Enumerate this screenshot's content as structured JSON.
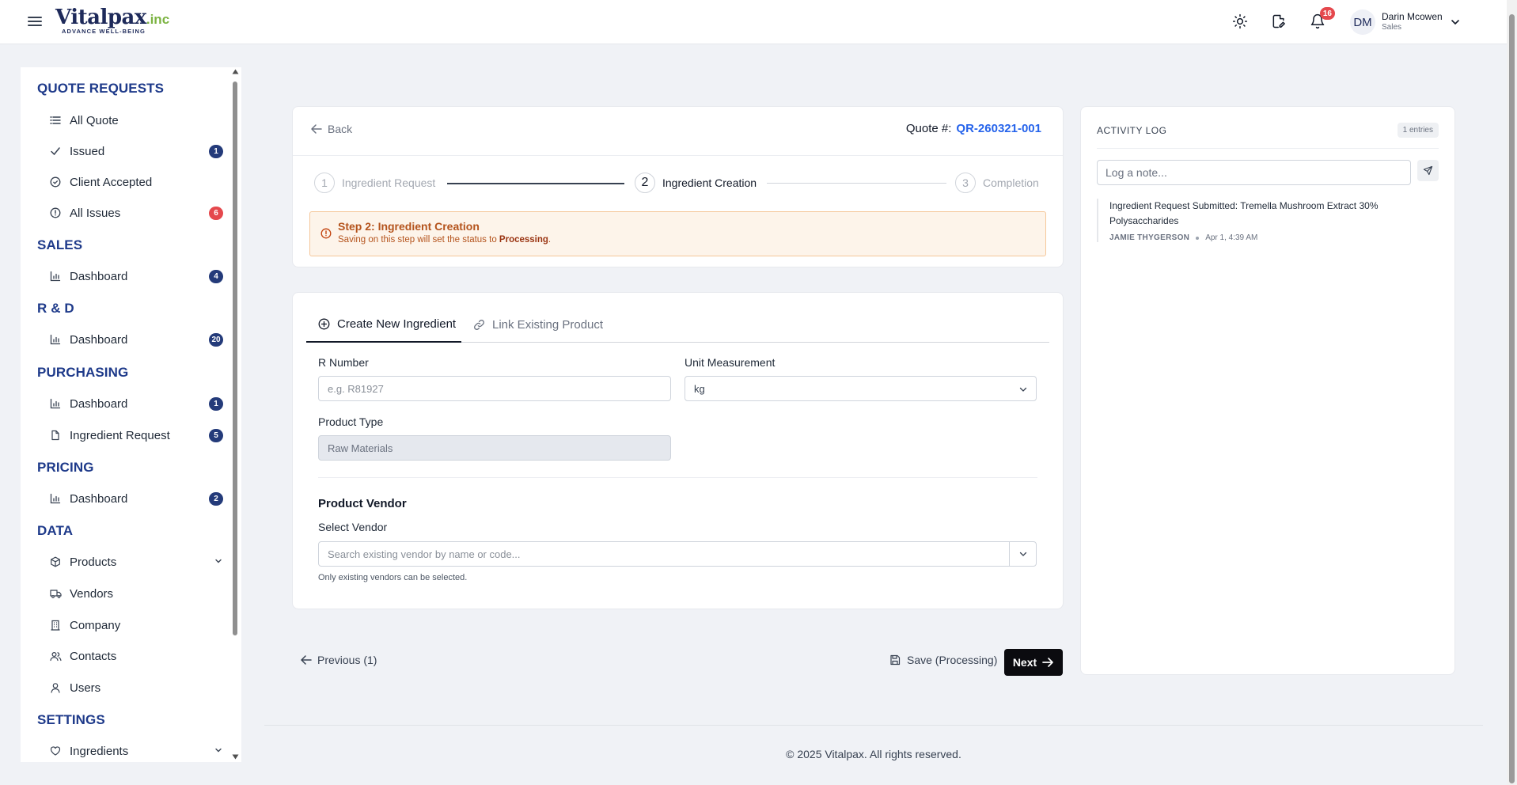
{
  "header": {
    "logo_main": "Vitalpax",
    "logo_suffix": ".inc",
    "logo_tagline": "ADVANCE WELL-BEING",
    "notification_count": "16",
    "user": {
      "initials": "DM",
      "name": "Darin Mcowen",
      "role": "Sales"
    }
  },
  "sidebar": {
    "sections": {
      "quote": "QUOTE REQUESTS",
      "sales": "SALES",
      "rnd": "R & D",
      "purchasing": "PURCHASING",
      "pricing": "PRICING",
      "data": "DATA",
      "settings": "SETTINGS"
    },
    "items": {
      "all_quote": "All Quote",
      "issued": "Issued",
      "issued_badge": "1",
      "client_accepted": "Client Accepted",
      "all_issues": "All Issues",
      "all_issues_badge": "6",
      "sales_dashboard": "Dashboard",
      "sales_badge": "4",
      "rnd_dashboard": "Dashboard",
      "rnd_badge": "20",
      "purchasing_dashboard": "Dashboard",
      "purchasing_badge": "1",
      "ingredient_request": "Ingredient Request",
      "ingredient_request_badge": "5",
      "pricing_dashboard": "Dashboard",
      "pricing_badge": "2",
      "products": "Products",
      "vendors": "Vendors",
      "company": "Company",
      "contacts": "Contacts",
      "users": "Users",
      "ingredients": "Ingredients"
    }
  },
  "quote_card": {
    "back_label": "Back",
    "quote_label": "Quote #:",
    "quote_number": "QR-260321-001",
    "steps": [
      {
        "num": "1",
        "label": "Ingredient Request"
      },
      {
        "num": "2",
        "label": "Ingredient Creation"
      },
      {
        "num": "3",
        "label": "Completion"
      }
    ],
    "alert_title": "Step 2: Ingredient Creation",
    "alert_text_pre": "Saving on this step will set the status to ",
    "alert_status": "Processing",
    "alert_text_post": "."
  },
  "form": {
    "tabs": {
      "create": "Create New Ingredient",
      "link": "Link Existing Product"
    },
    "r_number_label": "R Number",
    "r_number_placeholder": "e.g. R81927",
    "unit_label": "Unit Measurement",
    "unit_value": "kg",
    "product_type_label": "Product Type",
    "product_type_value": "Raw Materials",
    "vendor_section": "Product Vendor",
    "vendor_label": "Select Vendor",
    "vendor_placeholder": "Search existing vendor by name or code...",
    "vendor_help": "Only existing vendors can be selected."
  },
  "actions": {
    "previous": "Previous (1)",
    "save": "Save (Processing)",
    "next": "Next"
  },
  "footer": {
    "text": "© 2025 Vitalpax. All rights reserved."
  },
  "activity_log": {
    "title": "ACTIVITY LOG",
    "count": "1 entries",
    "note_placeholder": "Log a note...",
    "entries": [
      {
        "text": "Ingredient Request Submitted: Tremella Mushroom Extract 30% Polysaccharides",
        "user": "JAMIE THYGERSON",
        "time": "Apr 1, 4:39 AM"
      }
    ]
  },
  "colors": {
    "brand_navy": "#1e2a5a",
    "brand_green": "#7cb342",
    "section_blue": "#1e3a8a",
    "badge_navy": "#243b7a",
    "badge_red": "#e5484d",
    "link_blue": "#2563eb",
    "alert_orange": "#b4531c"
  }
}
